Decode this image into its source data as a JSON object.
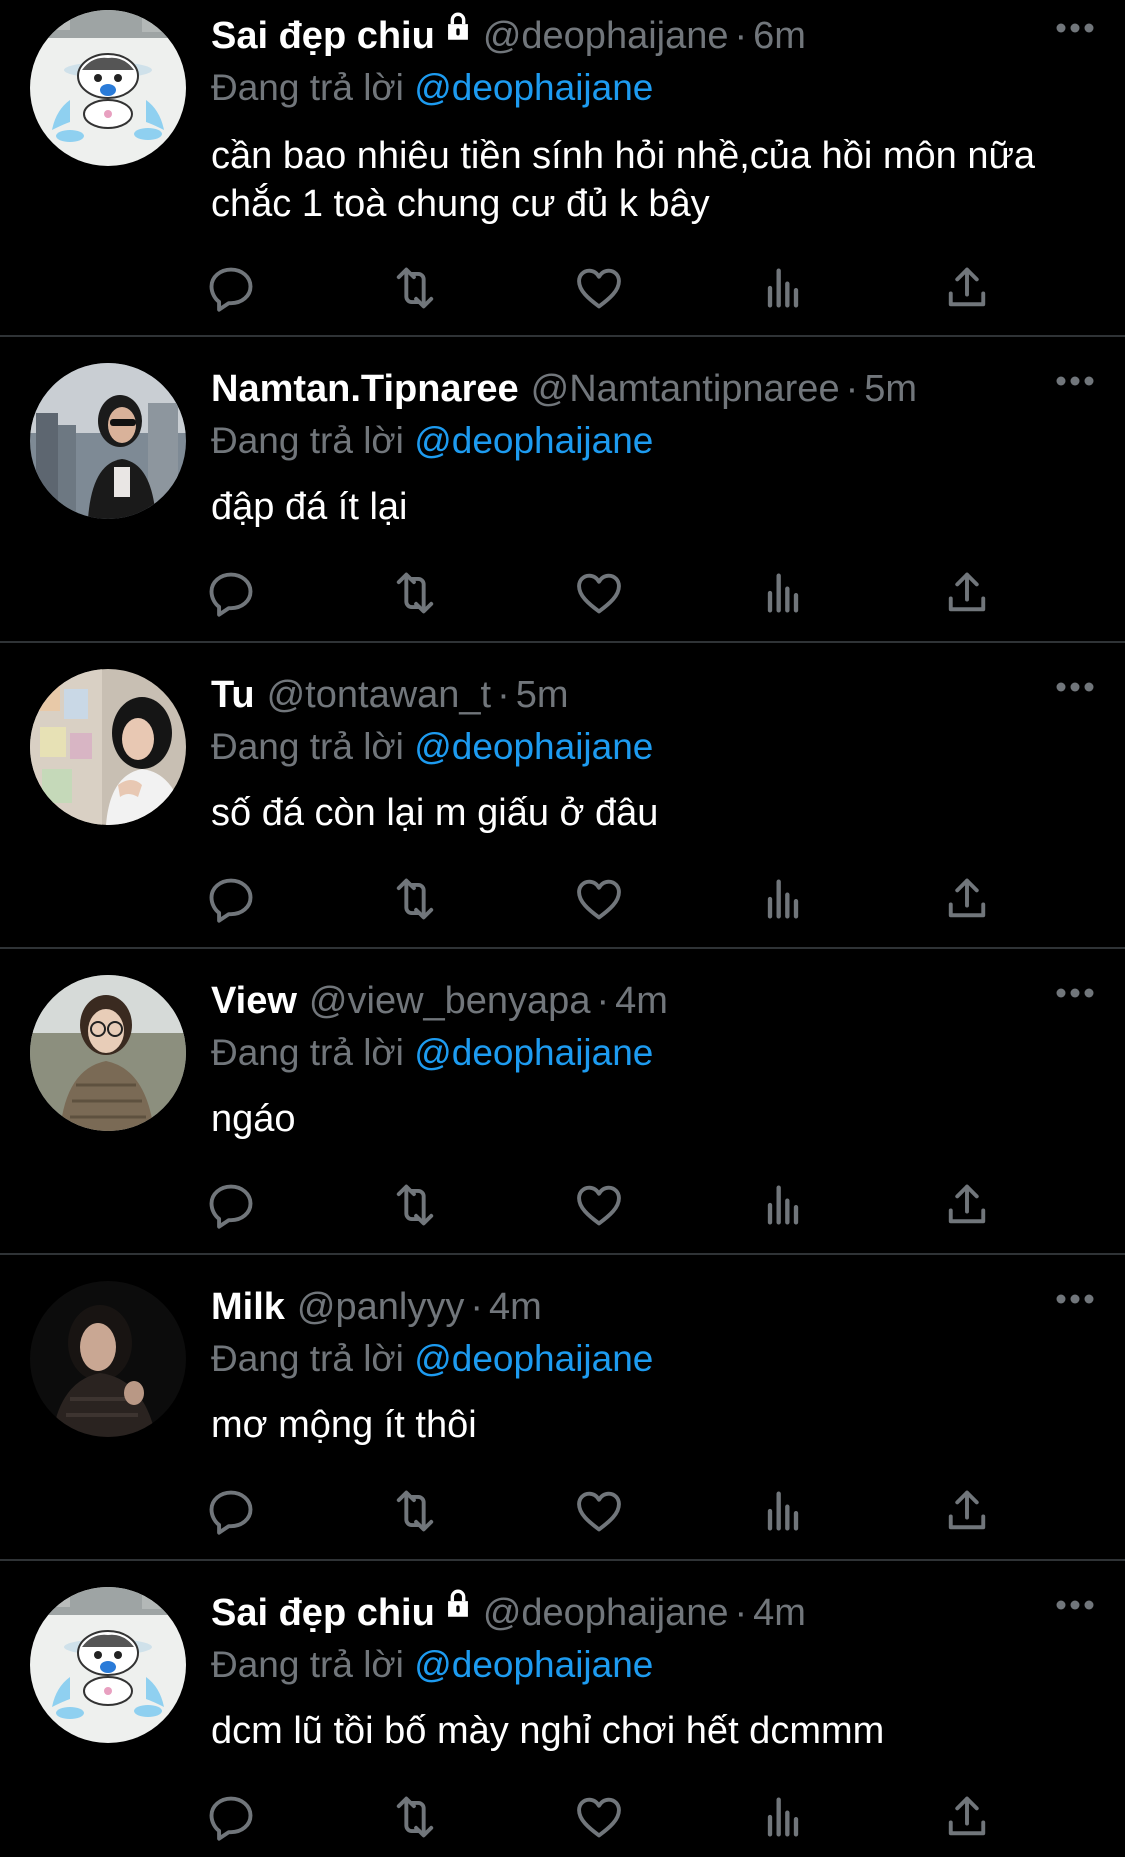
{
  "tweets": [
    {
      "name": "Sai đẹp chiu",
      "locked": true,
      "handle": "@deophaijane",
      "dot": "·",
      "time": "6m",
      "reply_prefix": "Đang trả lời",
      "reply_to": "@deophaijane",
      "text": "cần bao nhiêu tiền sính hỏi nhề,của hồi môn nữa chắc 1 toà chung cư đủ k bây"
    },
    {
      "name": "Namtan.Tipnaree",
      "locked": false,
      "handle": "@Namtantipnaree",
      "dot": "·",
      "time": "5m",
      "reply_prefix": "Đang trả lời",
      "reply_to": "@deophaijane",
      "text": "đập đá ít lại"
    },
    {
      "name": "Tu",
      "locked": false,
      "handle": "@tontawan_t",
      "dot": "·",
      "time": "5m",
      "reply_prefix": "Đang trả lời",
      "reply_to": "@deophaijane",
      "text": "số đá còn lại m giấu ở đâu"
    },
    {
      "name": "View",
      "locked": false,
      "handle": "@view_benyapa",
      "dot": "·",
      "time": "4m",
      "reply_prefix": "Đang trả lời",
      "reply_to": "@deophaijane",
      "text": "ngáo"
    },
    {
      "name": "Milk",
      "locked": false,
      "handle": "@panlyyy",
      "dot": "·",
      "time": "4m",
      "reply_prefix": "Đang trả lời",
      "reply_to": "@deophaijane",
      "text": "mơ mộng ít thôi"
    },
    {
      "name": "Sai đẹp chiu",
      "locked": true,
      "handle": "@deophaijane",
      "dot": "·",
      "time": "4m",
      "reply_prefix": "Đang trả lời",
      "reply_to": "@deophaijane",
      "text": "dcm lũ tồi bố mày nghỉ chơi hết dcmmm"
    }
  ],
  "icons": {
    "reply": "reply-icon",
    "retweet": "retweet-icon",
    "like": "like-icon",
    "views": "views-icon",
    "share": "share-icon",
    "more": "more-icon",
    "lock": "lock-icon"
  },
  "colors": {
    "background": "#000000",
    "text": "#ffffff",
    "muted": "#71767b",
    "link": "#1d9bf0",
    "divider": "#2f3336"
  }
}
